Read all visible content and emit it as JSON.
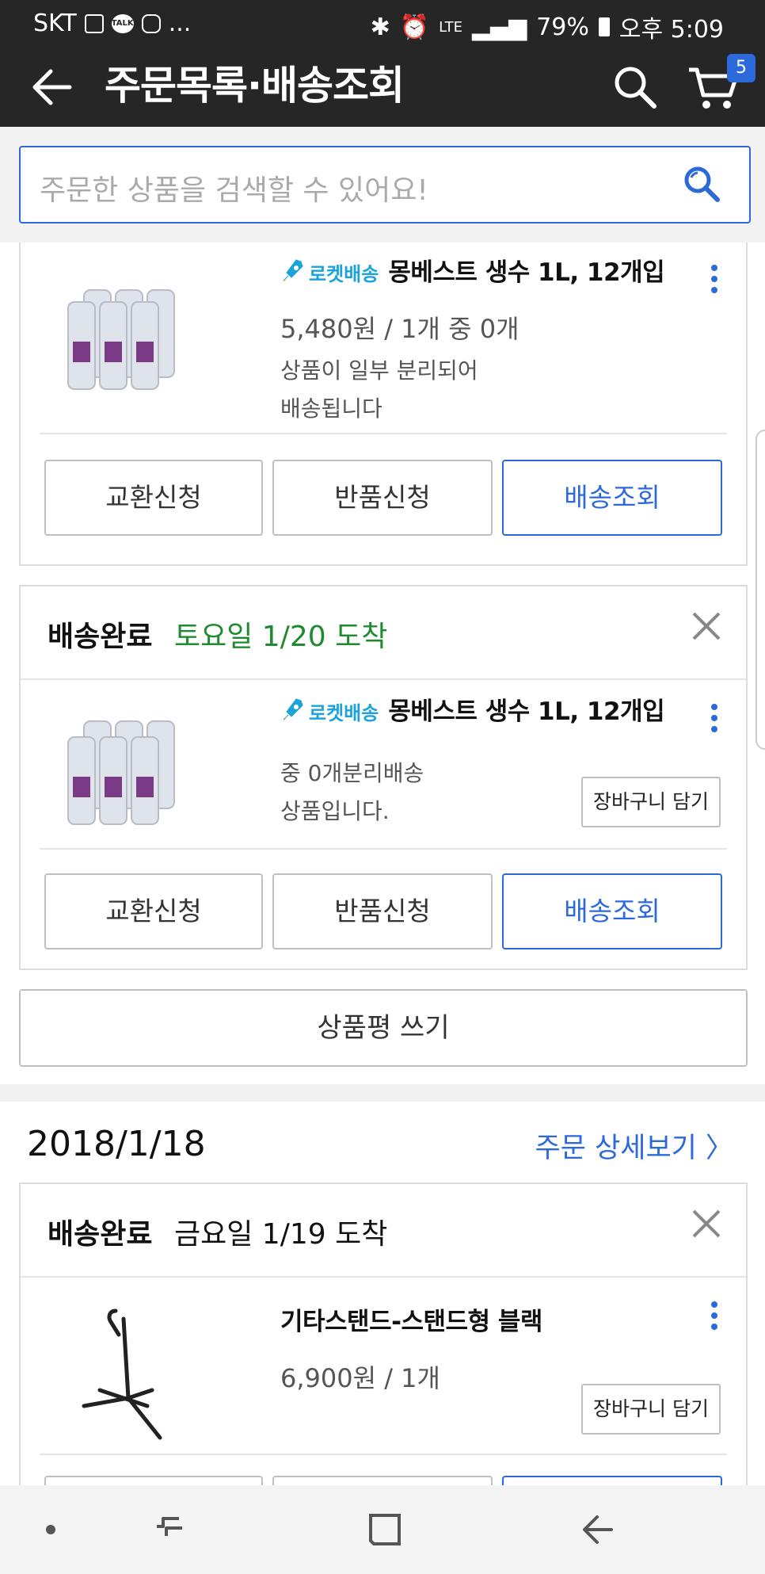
{
  "status_bar": {
    "carrier": "SKT",
    "more": "...",
    "talk": "TALK",
    "network": "LTE",
    "battery": "79%",
    "time": "오후 5:09"
  },
  "header": {
    "title": "주문목록·배송조회",
    "cart_count": "5"
  },
  "search": {
    "placeholder": "주문한 상품을 검색할 수 있어요!"
  },
  "orders": [
    {
      "items": [
        {
          "rocket_label": "로켓배송",
          "name": "몽베스트 생수 1L, 12개입",
          "price_line": "5,480원 / 1개 중 0개",
          "note_line1": "상품이 일부 분리되어",
          "note_line2": "배송됩니다",
          "buttons": [
            "교환신청",
            "반품신청",
            "배송조회"
          ]
        }
      ]
    },
    {
      "status": "배송완료",
      "arrival": "토요일 1/20 도착",
      "items": [
        {
          "rocket_label": "로켓배송",
          "name": "몽베스트 생수 1L, 12개입",
          "note_line1": "중 0개분리배송",
          "note_line2": "상품입니다.",
          "cart_button": "장바구니 담기",
          "buttons": [
            "교환신청",
            "반품신청",
            "배송조회"
          ]
        }
      ],
      "review_button": "상품평 쓰기"
    },
    {
      "date": "2018/1/18",
      "detail_link": "주문 상세보기 〉",
      "status": "배송완료",
      "arrival": "금요일 1/19 도착",
      "items": [
        {
          "name": "기타스탠드-스탠드형 블랙",
          "price_line": "6,900원 / 1개",
          "cart_button": "장바구니 담기"
        }
      ]
    }
  ],
  "colors": {
    "accent": "#2d6ad9",
    "arrival_green": "#1e8c2e",
    "rocket": "#1ba4d9",
    "header_bg": "#262626"
  }
}
